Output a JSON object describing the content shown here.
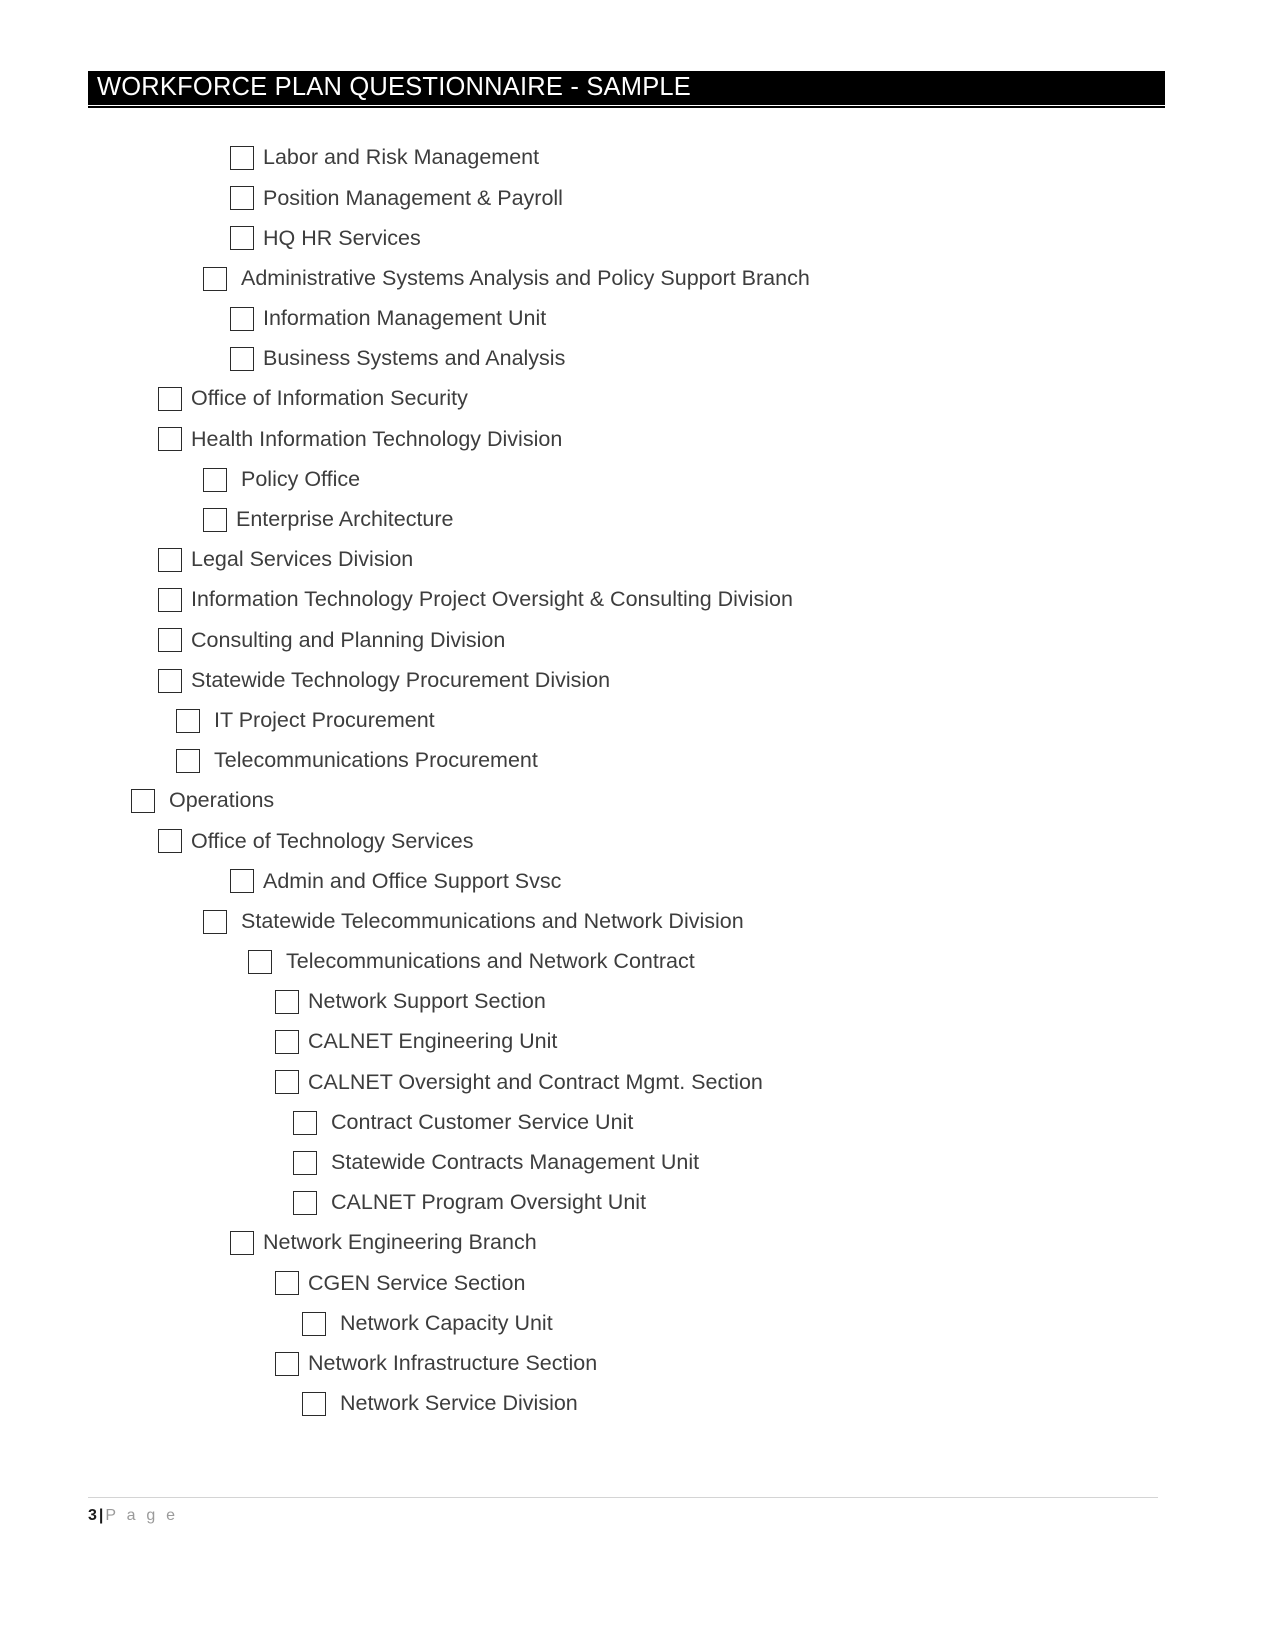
{
  "document": {
    "header": {
      "title": "WORKFORCE PLAN QUESTIONNAIRE - SAMPLE"
    },
    "footer": {
      "page_number": "3",
      "separator": "|",
      "page_word": "P a g e"
    }
  },
  "checklist": {
    "items": [
      {
        "label": "Labor and Risk Management",
        "indent": 230,
        "extra_pad": false
      },
      {
        "label": "Position Management & Payroll",
        "indent": 230,
        "extra_pad": false
      },
      {
        "label": "HQ HR Services",
        "indent": 230,
        "extra_pad": false
      },
      {
        "label": "Administrative Systems Analysis and Policy Support Branch",
        "indent": 203,
        "extra_pad": true
      },
      {
        "label": "Information Management Unit",
        "indent": 230,
        "extra_pad": false
      },
      {
        "label": "Business Systems and Analysis",
        "indent": 230,
        "extra_pad": false
      },
      {
        "label": "Office of Information Security",
        "indent": 158,
        "extra_pad": false
      },
      {
        "label": "Health Information Technology Division",
        "indent": 158,
        "extra_pad": false
      },
      {
        "label": "Policy Office",
        "indent": 203,
        "extra_pad": true
      },
      {
        "label": "Enterprise Architecture",
        "indent": 203,
        "extra_pad": false
      },
      {
        "label": "Legal Services Division",
        "indent": 158,
        "extra_pad": false
      },
      {
        "label": "Information Technology Project Oversight & Consulting Division",
        "indent": 158,
        "extra_pad": false
      },
      {
        "label": "Consulting and Planning Division",
        "indent": 158,
        "extra_pad": false
      },
      {
        "label": "Statewide Technology Procurement Division",
        "indent": 158,
        "extra_pad": false
      },
      {
        "label": "IT Project Procurement",
        "indent": 176,
        "extra_pad": true
      },
      {
        "label": "Telecommunications Procurement",
        "indent": 176,
        "extra_pad": true
      },
      {
        "label": "Operations",
        "indent": 131,
        "extra_pad": true
      },
      {
        "label": "Office of Technology Services",
        "indent": 158,
        "extra_pad": false
      },
      {
        "label": "Admin and Office Support Svsc",
        "indent": 230,
        "extra_pad": false
      },
      {
        "label": "Statewide Telecommunications and Network Division",
        "indent": 203,
        "extra_pad": true
      },
      {
        "label": "Telecommunications and Network Contract",
        "indent": 248,
        "extra_pad": true
      },
      {
        "label": "Network Support Section",
        "indent": 275,
        "extra_pad": false
      },
      {
        "label": "CALNET Engineering Unit",
        "indent": 275,
        "extra_pad": false
      },
      {
        "label": "CALNET Oversight and Contract Mgmt. Section",
        "indent": 275,
        "extra_pad": false
      },
      {
        "label": "Contract Customer Service Unit",
        "indent": 293,
        "extra_pad": true
      },
      {
        "label": "Statewide Contracts Management Unit",
        "indent": 293,
        "extra_pad": true
      },
      {
        "label": "CALNET Program Oversight Unit",
        "indent": 293,
        "extra_pad": true
      },
      {
        "label": "Network Engineering Branch",
        "indent": 230,
        "extra_pad": false
      },
      {
        "label": "CGEN Service Section",
        "indent": 275,
        "extra_pad": false
      },
      {
        "label": "Network Capacity Unit",
        "indent": 302,
        "extra_pad": true
      },
      {
        "label": "Network Infrastructure Section",
        "indent": 275,
        "extra_pad": false
      },
      {
        "label": "Network Service Division",
        "indent": 302,
        "extra_pad": true
      }
    ]
  }
}
